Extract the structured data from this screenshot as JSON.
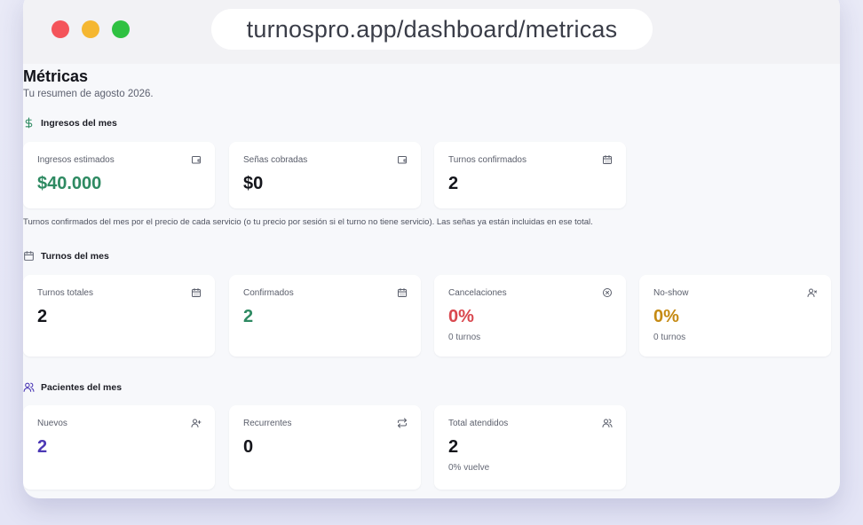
{
  "browser": {
    "url": "turnospro.app/dashboard/metricas"
  },
  "page": {
    "title": "Métricas",
    "subtitle": "Tu resumen de agosto 2026."
  },
  "sections": {
    "ingresos": {
      "title": "Ingresos del mes",
      "note": "Turnos confirmados del mes por el precio de cada servicio (o tu precio por sesión si el turno no tiene servicio). Las señas ya están incluidas en ese total.",
      "cards": [
        {
          "label": "Ingresos estimados",
          "value": "$40.000",
          "icon": "wallet-icon"
        },
        {
          "label": "Señas cobradas",
          "value": "$0",
          "icon": "wallet-icon"
        },
        {
          "label": "Turnos confirmados",
          "value": "2",
          "icon": "calendar-icon"
        }
      ]
    },
    "turnos": {
      "title": "Turnos del mes",
      "cards": [
        {
          "label": "Turnos totales",
          "value": "2",
          "icon": "calendar-icon"
        },
        {
          "label": "Confirmados",
          "value": "2",
          "icon": "calendar-icon"
        },
        {
          "label": "Cancelaciones",
          "value": "0%",
          "sub": "0 turnos",
          "icon": "circle-x-icon"
        },
        {
          "label": "No-show",
          "value": "0%",
          "sub": "0 turnos",
          "icon": "user-x-icon"
        }
      ]
    },
    "pacientes": {
      "title": "Pacientes del mes",
      "cards": [
        {
          "label": "Nuevos",
          "value": "2",
          "icon": "user-plus-icon"
        },
        {
          "label": "Recurrentes",
          "value": "0",
          "icon": "repeat-icon"
        },
        {
          "label": "Total atendidos",
          "value": "2",
          "sub": "0% vuelve",
          "icon": "users-icon"
        }
      ]
    }
  },
  "colors": {
    "green": "#2e8a62",
    "red": "#d9474e",
    "amber": "#c58a13",
    "purple": "#4c39b5"
  }
}
